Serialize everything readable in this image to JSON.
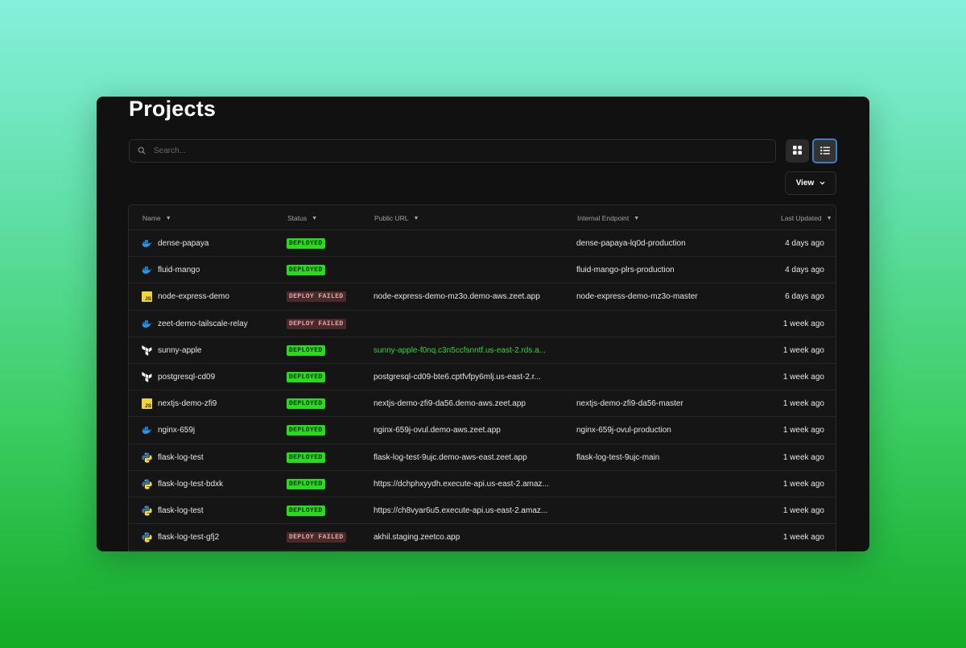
{
  "page": {
    "title": "Projects"
  },
  "search": {
    "placeholder": "Search..."
  },
  "toolbar": {
    "view_label": "View"
  },
  "table": {
    "columns": {
      "name": "Name",
      "status": "Status",
      "public_url": "Public URL",
      "internal_endpoint": "Internal Endpoint",
      "last_updated": "Last Updated"
    },
    "rows": [
      {
        "icon": "docker",
        "name": "dense-papaya",
        "status": "DEPLOYED",
        "status_kind": "ok",
        "public_url": "",
        "url_link": false,
        "internal": "dense-papaya-lq0d-production",
        "updated": "4 days ago"
      },
      {
        "icon": "docker",
        "name": "fluid-mango",
        "status": "DEPLOYED",
        "status_kind": "ok",
        "public_url": "",
        "url_link": false,
        "internal": "fluid-mango-plrs-production",
        "updated": "4 days ago"
      },
      {
        "icon": "js",
        "name": "node-express-demo",
        "status": "DEPLOY FAILED",
        "status_kind": "fail",
        "public_url": "node-express-demo-mz3o.demo-aws.zeet.app",
        "url_link": false,
        "internal": "node-express-demo-mz3o-master",
        "updated": "6 days ago"
      },
      {
        "icon": "docker",
        "name": "zeet-demo-tailscale-relay",
        "status": "DEPLOY FAILED",
        "status_kind": "fail",
        "public_url": "",
        "url_link": false,
        "internal": "",
        "updated": "1 week ago"
      },
      {
        "icon": "terraform",
        "name": "sunny-apple",
        "status": "DEPLOYED",
        "status_kind": "ok",
        "public_url": "sunny-apple-f0nq.c3n5ccfsnntf.us-east-2.rds.a...",
        "url_link": true,
        "internal": "",
        "updated": "1 week ago"
      },
      {
        "icon": "terraform",
        "name": "postgresql-cd09",
        "status": "DEPLOYED",
        "status_kind": "ok",
        "public_url": "postgresql-cd09-bte6.cptfvfpy6mlj.us-east-2.r...",
        "url_link": false,
        "internal": "",
        "updated": "1 week ago"
      },
      {
        "icon": "js",
        "name": "nextjs-demo-zfi9",
        "status": "DEPLOYED",
        "status_kind": "ok",
        "public_url": "nextjs-demo-zfi9-da56.demo-aws.zeet.app",
        "url_link": false,
        "internal": "nextjs-demo-zfi9-da56-master",
        "updated": "1 week ago"
      },
      {
        "icon": "docker",
        "name": "nginx-659j",
        "status": "DEPLOYED",
        "status_kind": "ok",
        "public_url": "nginx-659j-ovul.demo-aws.zeet.app",
        "url_link": false,
        "internal": "nginx-659j-ovul-production",
        "updated": "1 week ago"
      },
      {
        "icon": "python",
        "name": "flask-log-test",
        "status": "DEPLOYED",
        "status_kind": "ok",
        "public_url": "flask-log-test-9ujc.demo-aws-east.zeet.app",
        "url_link": false,
        "internal": "flask-log-test-9ujc-main",
        "updated": "1 week ago"
      },
      {
        "icon": "python",
        "name": "flask-log-test-bdxk",
        "status": "DEPLOYED",
        "status_kind": "ok",
        "public_url": "https://dchphxyydh.execute-api.us-east-2.amaz...",
        "url_link": false,
        "internal": "",
        "updated": "1 week ago"
      },
      {
        "icon": "python",
        "name": "flask-log-test",
        "status": "DEPLOYED",
        "status_kind": "ok",
        "public_url": "https://ch8vyar6u5.execute-api.us-east-2.amaz...",
        "url_link": false,
        "internal": "",
        "updated": "1 week ago"
      },
      {
        "icon": "python",
        "name": "flask-log-test-gfj2",
        "status": "DEPLOY FAILED",
        "status_kind": "fail",
        "public_url": "akhil.staging.zeetco.app",
        "url_link": false,
        "internal": "",
        "updated": "1 week ago"
      }
    ]
  },
  "colors": {
    "deployed": "#25dd19",
    "deploy_failed_bg": "#4a2a2a",
    "link": "#36d13c",
    "accent": "#3b7ec6"
  }
}
